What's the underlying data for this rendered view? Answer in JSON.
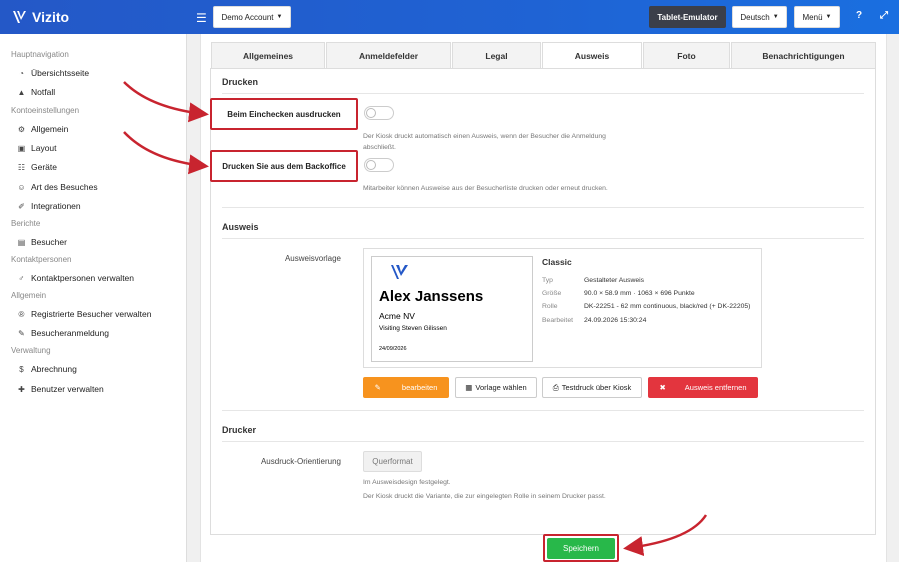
{
  "app": {
    "name": "Vizito"
  },
  "topbar": {
    "account_label": "Demo Account",
    "tablet_emulator": "Tablet-Emulator",
    "language": "Deutsch",
    "menu": "Menü",
    "help_icon": "question-icon",
    "expand_icon": "expand-icon"
  },
  "sidebar": {
    "sections": [
      {
        "label": "Hauptnavigation",
        "items": [
          {
            "label": "Übersichtsseite",
            "icon": "dashboard-icon"
          },
          {
            "label": "Notfall",
            "icon": "warning-icon"
          }
        ]
      },
      {
        "label": "Kontoeinstellungen",
        "items": [
          {
            "label": "Allgemein",
            "icon": "gear-icon"
          },
          {
            "label": "Layout",
            "icon": "image-icon"
          },
          {
            "label": "Geräte",
            "icon": "sitemap-icon"
          },
          {
            "label": "Art des Besuches",
            "icon": "users-icon"
          },
          {
            "label": "Integrationen",
            "icon": "plug-icon"
          }
        ]
      },
      {
        "label": "Berichte",
        "items": [
          {
            "label": "Besucher",
            "icon": "book-icon"
          }
        ]
      },
      {
        "label": "Kontaktpersonen",
        "items": [
          {
            "label": "Kontaktpersonen verwalten",
            "icon": "user-icon"
          }
        ]
      },
      {
        "label": "Allgemein",
        "items": [
          {
            "label": "Registrierte Besucher verwalten",
            "icon": "registered-icon"
          },
          {
            "label": "Besucheranmeldung",
            "icon": "pencil-icon"
          }
        ]
      },
      {
        "label": "Verwaltung",
        "items": [
          {
            "label": "Abrechnung",
            "icon": "dollar-icon"
          },
          {
            "label": "Benutzer verwalten",
            "icon": "user-plus-icon"
          }
        ]
      }
    ]
  },
  "tabs": [
    {
      "label": "Allgemeines",
      "active": false
    },
    {
      "label": "Anmeldefelder",
      "active": false
    },
    {
      "label": "Legal",
      "active": false
    },
    {
      "label": "Ausweis",
      "active": true
    },
    {
      "label": "Foto",
      "active": false
    },
    {
      "label": "Benachrichtigungen",
      "active": false
    }
  ],
  "drucken": {
    "title": "Drucken",
    "checkin_label": "Beim Einchecken ausdrucken",
    "checkin_on": false,
    "checkin_help": "Der Kiosk druckt automatisch einen Ausweis, wenn der Besucher die Anmeldung abschließt.",
    "backoffice_label": "Drucken Sie aus dem Backoffice",
    "backoffice_on": false,
    "backoffice_help": "Mitarbeiter können Ausweise aus der Besucherliste drucken oder erneut drucken."
  },
  "ausweis": {
    "title": "Ausweis",
    "template_label": "Ausweisvorlage",
    "card": {
      "name": "Alex Janssens",
      "company": "Acme NV",
      "visiting": "Visiting Steven Gilissen",
      "date": "24/09/2026"
    },
    "template_name": "Classic",
    "meta": [
      {
        "key": "Typ",
        "value": "Gestalteter Ausweis"
      },
      {
        "key": "Größe",
        "value": "90.0 × 58.9 mm · 1063 × 696 Punkte"
      },
      {
        "key": "Rolle",
        "value": "DK-22251 - 62 mm continuous, black/red (+ DK-22205)"
      },
      {
        "key": "Bearbeitet",
        "value": "24.09.2026 15:30:24"
      }
    ],
    "buttons": {
      "edit": "bearbeiten",
      "choose_template": "Vorlage wählen",
      "test_print": "Testdruck über Kiosk",
      "remove": "Ausweis entfernen"
    }
  },
  "drucker": {
    "title": "Drucker",
    "orientation_label": "Ausdruck-Orientierung",
    "orientation_value": "Querformat",
    "help1": "Im Ausweisdesign festgelegt.",
    "help2": "Der Kiosk druckt die Variante, die zur eingelegten Rolle in seinem Drucker passt."
  },
  "save_label": "Speichern",
  "colors": {
    "brand_blue": "#2458c7",
    "annotation_red": "#c8242f",
    "edit_orange": "#f7931e",
    "remove_red": "#e3353e",
    "save_green": "#28b84a"
  }
}
